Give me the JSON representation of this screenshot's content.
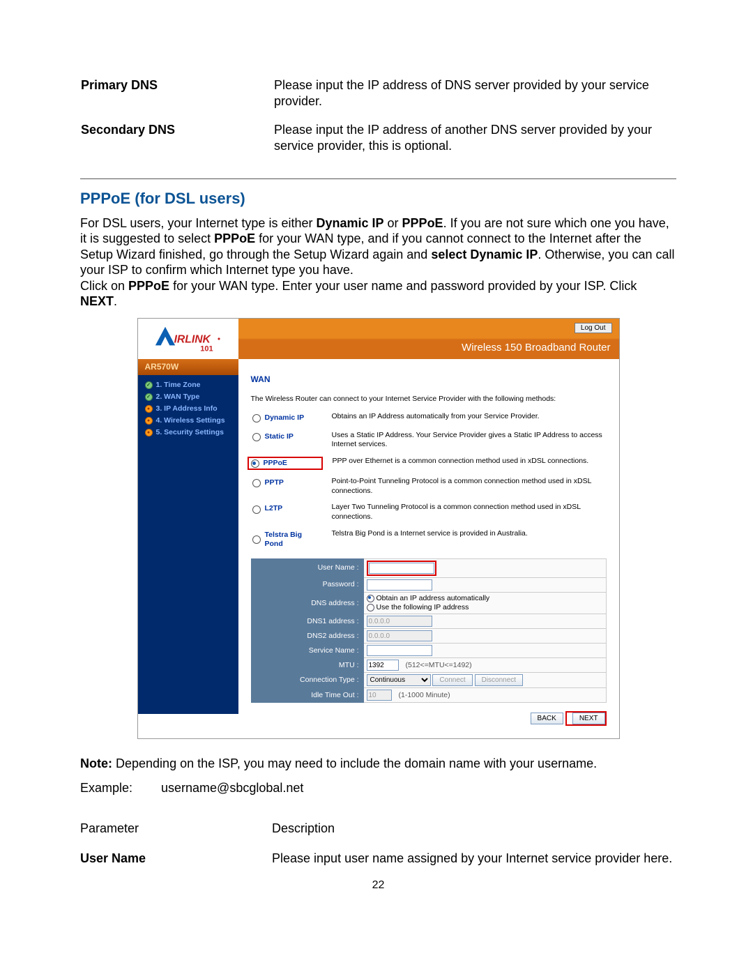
{
  "dns_table": {
    "rows": [
      {
        "label": "Primary DNS",
        "desc": "Please input the IP address of DNS server provided by your service provider."
      },
      {
        "label": "Secondary DNS",
        "desc": "Please input the IP address of another DNS server provided by your service provider, this is optional."
      }
    ]
  },
  "section_title": "PPPoE (for DSL users)",
  "body": {
    "t1a": "For DSL users, your Internet type is either ",
    "b1": "Dynamic IP",
    "t1b": " or ",
    "b2": "PPPoE",
    "t1c": ". If you are not sure which one you have, it is suggested to select ",
    "b3": "PPPoE",
    "t1d": " for your WAN type, and if you cannot connect to the Internet after the Setup Wizard finished, go through the Setup Wizard again and ",
    "b4": "select Dynamic IP",
    "t1e": ". Otherwise, you can call your ISP to confirm which Internet type you have.",
    "t2a": "Click on ",
    "b5": "PPPoE",
    "t2b": " for your WAN type. Enter your user name and password provided by your ISP. Click ",
    "b6": "NEXT",
    "t2c": "."
  },
  "router": {
    "logo_text": "IRLINK",
    "logo_sub": "101",
    "logout": "Log Out",
    "header_title": "Wireless 150 Broadband Router",
    "model": "AR570W",
    "sidebar": [
      {
        "label": "1. Time Zone",
        "state": "done"
      },
      {
        "label": "2. WAN Type",
        "state": "done"
      },
      {
        "label": "3. IP Address Info",
        "state": "active"
      },
      {
        "label": "4. Wireless Settings",
        "state": "active"
      },
      {
        "label": "5. Security Settings",
        "state": "active"
      }
    ],
    "wan_title": "WAN",
    "wan_sub": "The Wireless Router can connect to your Internet Service Provider with the following methods:",
    "wan_types": [
      {
        "name": "Dynamic IP",
        "desc": "Obtains an IP Address automatically from your Service Provider.",
        "selected": false,
        "hl": false
      },
      {
        "name": "Static IP",
        "desc": "Uses a Static IP Address. Your Service Provider gives a Static IP Address to access Internet services.",
        "selected": false,
        "hl": false
      },
      {
        "name": "PPPoE",
        "desc": "PPP over Ethernet is a common connection method used in xDSL connections.",
        "selected": true,
        "hl": true
      },
      {
        "name": "PPTP",
        "desc": "Point-to-Point Tunneling Protocol is a common connection method used in xDSL connections.",
        "selected": false,
        "hl": false
      },
      {
        "name": "L2TP",
        "desc": "Layer Two Tunneling Protocol is a common connection method used in xDSL connections.",
        "selected": false,
        "hl": false
      },
      {
        "name": "Telstra Big Pond",
        "desc": "Telstra Big Pond is a Internet service is provided in Australia.",
        "selected": false,
        "hl": false
      }
    ],
    "form": {
      "username_label": "User Name :",
      "password_label": "Password :",
      "dns_addr_label": "DNS address :",
      "dns_opt1": "Obtain an IP address automatically",
      "dns_opt2": "Use the following IP address",
      "dns1_label": "DNS1 address :",
      "dns1_value": "0.0.0.0",
      "dns2_label": "DNS2 address :",
      "dns2_value": "0.0.0.0",
      "service_label": "Service Name :",
      "mtu_label": "MTU :",
      "mtu_value": "1392",
      "mtu_hint": "(512<=MTU<=1492)",
      "conn_type_label": "Connection Type :",
      "conn_type_value": "Continuous",
      "connect_btn": "Connect",
      "disconnect_btn": "Disconnect",
      "idle_label": "Idle Time Out :",
      "idle_value": "10",
      "idle_hint": "(1-1000 Minute)",
      "back_btn": "BACK",
      "next_btn": "NEXT"
    }
  },
  "note": {
    "b": "Note:",
    "t": " Depending on the ISP, you may need to include the domain name with your username."
  },
  "example_label": "Example:",
  "example_value": "username@sbcglobal.net",
  "desc_table": {
    "hdr_param": "Parameter",
    "hdr_desc": "Description",
    "row1_label": "User Name",
    "row1_desc": "Please input user name assigned by your Internet service provider here."
  },
  "page_number": "22"
}
